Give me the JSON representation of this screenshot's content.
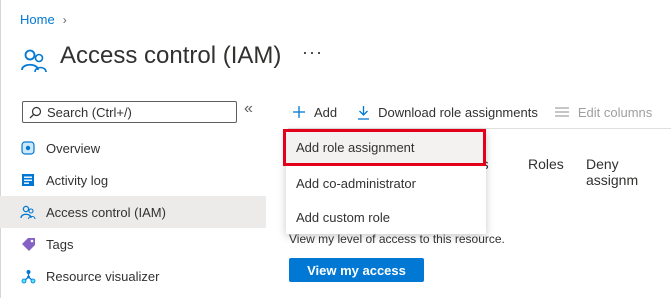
{
  "breadcrumb": {
    "home": "Home",
    "separator": "›"
  },
  "page": {
    "title": "Access control (IAM)",
    "more": "···"
  },
  "search": {
    "placeholder": "Search (Ctrl+/)"
  },
  "collapse_glyph": "«",
  "nav": {
    "items": [
      {
        "label": "Overview",
        "icon": "overview-icon"
      },
      {
        "label": "Activity log",
        "icon": "activity-log-icon"
      },
      {
        "label": "Access control (IAM)",
        "icon": "access-control-icon",
        "active": true
      },
      {
        "label": "Tags",
        "icon": "tag-icon"
      },
      {
        "label": "Resource visualizer",
        "icon": "resource-visualizer-icon"
      }
    ]
  },
  "toolbar": {
    "add": "Add",
    "download": "Download role assignments",
    "edit_columns": "Edit columns"
  },
  "tabs": {
    "partial": "nts",
    "roles": "Roles",
    "deny": "Deny assignm"
  },
  "dropdown": {
    "items": [
      {
        "label": "Add role assignment",
        "highlighted": true
      },
      {
        "label": "Add co-administrator"
      },
      {
        "label": "Add custom role"
      }
    ]
  },
  "access": {
    "description": "View my level of access to this resource.",
    "button": "View my access"
  },
  "colors": {
    "accent": "#0078d4",
    "highlight": "#e3001b",
    "active_bg": "#edebe9"
  }
}
